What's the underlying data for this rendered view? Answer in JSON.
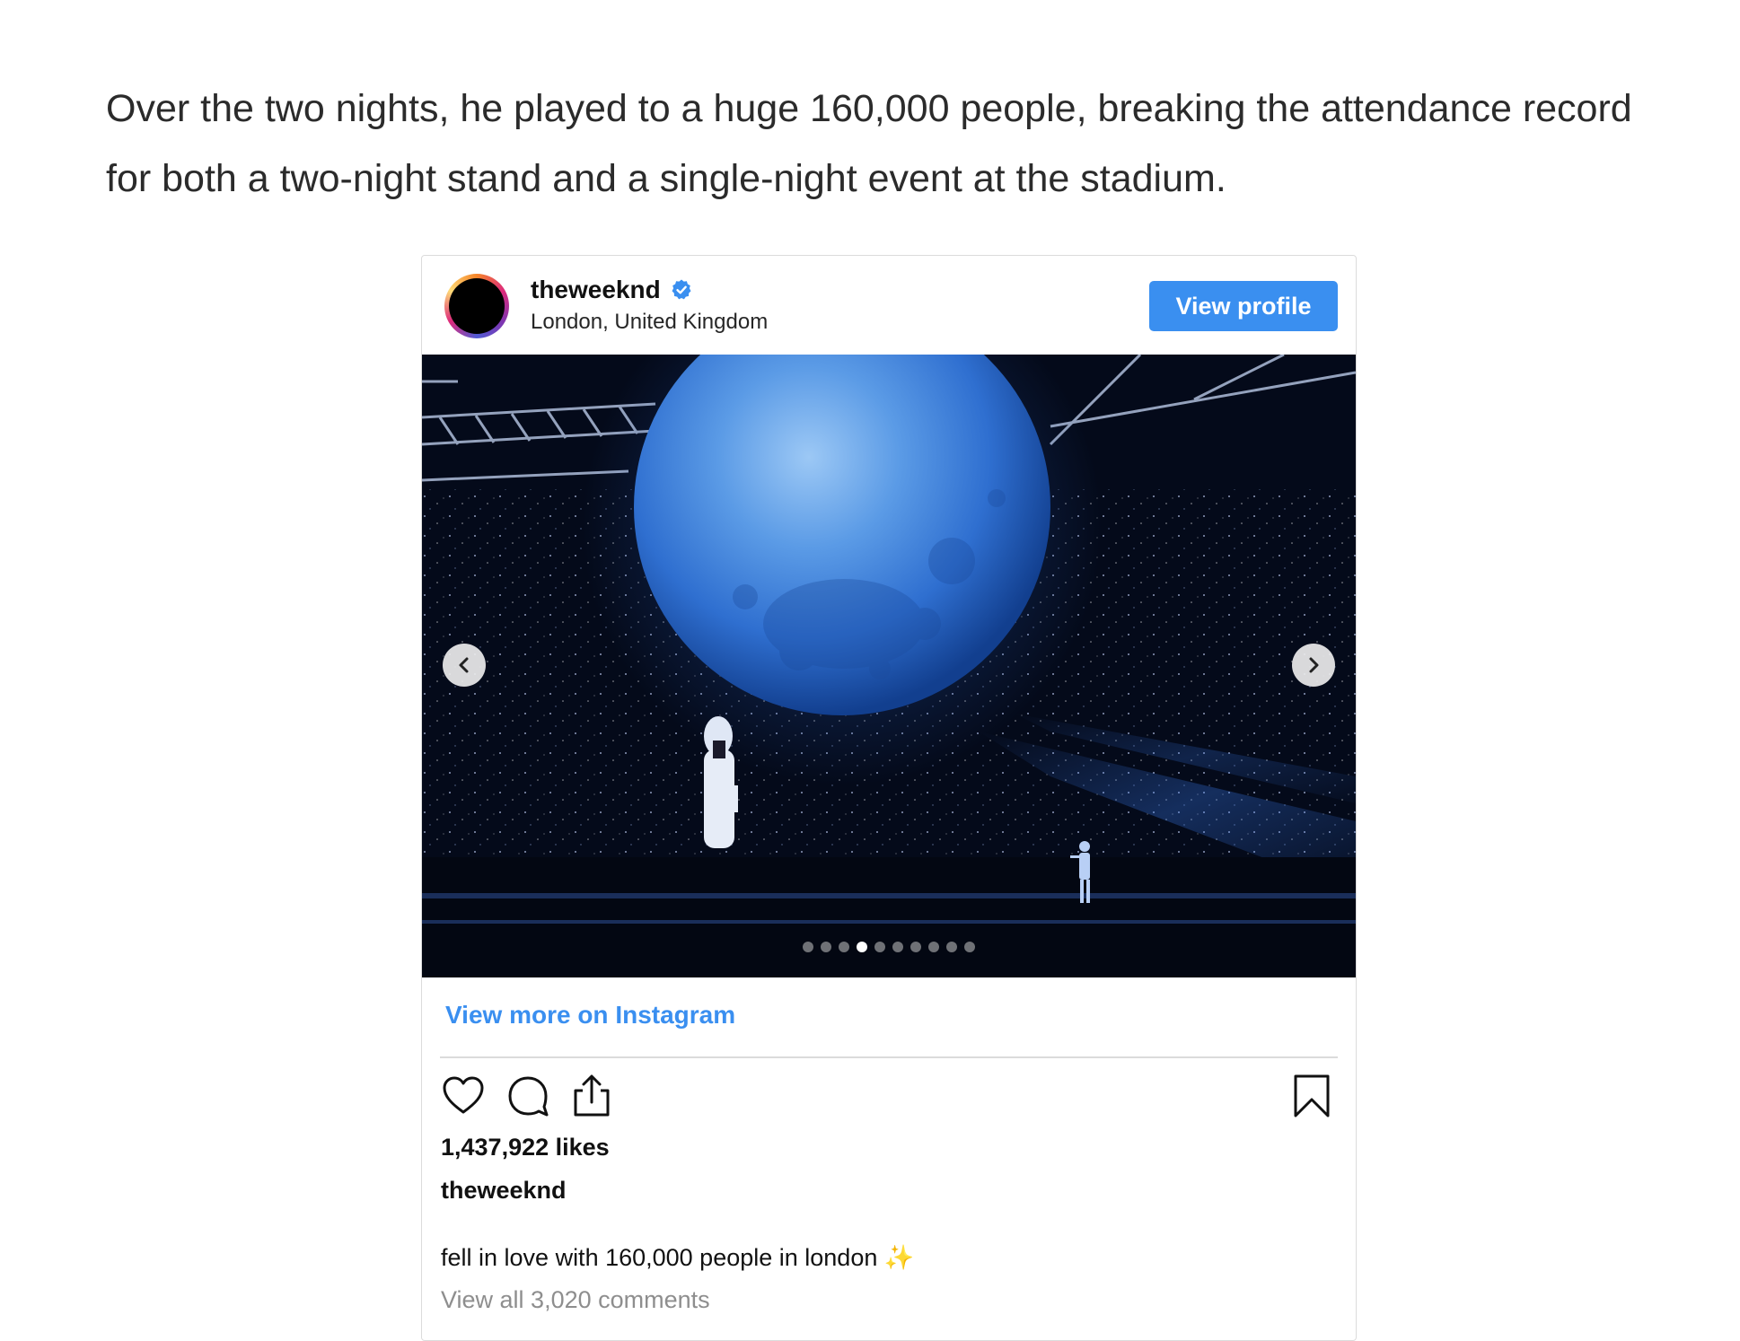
{
  "article": {
    "paragraph": "Over the two nights, he played to a huge 160,000 people, breaking the attendance record for both a two-night stand and a single-night event at the stadium."
  },
  "embed": {
    "username": "theweeknd",
    "location": "London, United Kingdom",
    "view_profile_label": "View profile",
    "view_more_label": "View more on Instagram",
    "likes": "1,437,922 likes",
    "caption_username": "theweeknd",
    "caption_text": "fell in love with 160,000 people in london",
    "caption_emoji": "✨",
    "comments_link": "View all 3,020 comments",
    "carousel": {
      "total_slides": 10,
      "active_index": 3
    },
    "colors": {
      "accent": "#3a8ff0",
      "muted_text": "#8e8e8e",
      "border": "#dbdbdb"
    },
    "icons": {
      "verified": "verified-badge-icon",
      "like": "heart-icon",
      "comment": "comment-bubble-icon",
      "share": "share-icon",
      "save": "bookmark-icon",
      "prev": "chevron-left-icon",
      "next": "chevron-right-icon"
    }
  }
}
